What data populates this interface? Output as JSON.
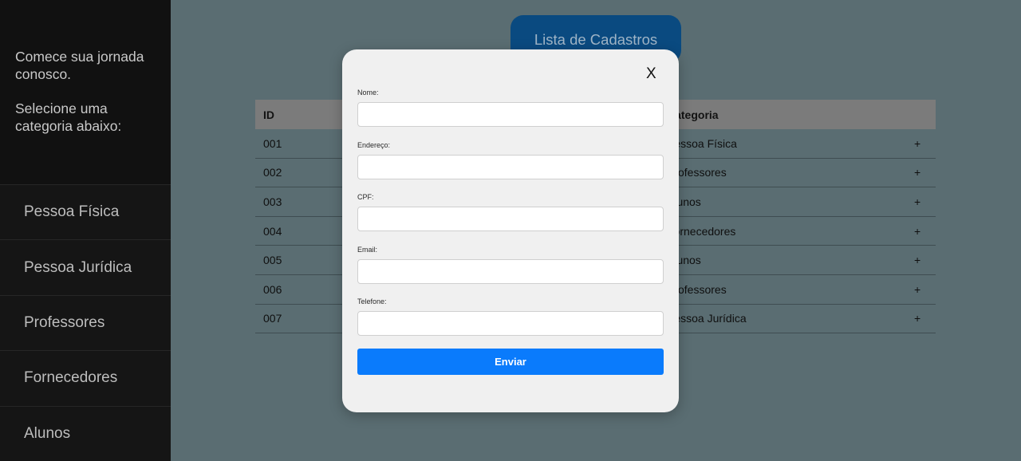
{
  "sidebar": {
    "intro_line1": "Comece sua jornada conosco.",
    "intro_line2": "Selecione uma categoria abaixo:",
    "items": [
      {
        "label": "Pessoa Física"
      },
      {
        "label": "Pessoa Jurídica"
      },
      {
        "label": "Professores"
      },
      {
        "label": "Fornecedores"
      },
      {
        "label": "Alunos"
      }
    ]
  },
  "header": {
    "button_label": "Lista de Cadastros"
  },
  "table": {
    "columns": [
      "ID",
      "Categoria"
    ],
    "rows": [
      {
        "id": "001",
        "category": "Pessoa Física",
        "action": "+"
      },
      {
        "id": "002",
        "category": "Professores",
        "action": "+"
      },
      {
        "id": "003",
        "category": "Alunos",
        "action": "+"
      },
      {
        "id": "004",
        "category": "Fornecedores",
        "action": "+"
      },
      {
        "id": "005",
        "category": "Alunos",
        "action": "+"
      },
      {
        "id": "006",
        "category": "Professores",
        "action": "+"
      },
      {
        "id": "007",
        "category": "Pessoa Jurídica",
        "action": "+"
      }
    ]
  },
  "modal": {
    "close_label": "X",
    "fields": [
      {
        "label": "Nome:",
        "value": ""
      },
      {
        "label": "Endereço:",
        "value": ""
      },
      {
        "label": "CPF:",
        "value": ""
      },
      {
        "label": "Email:",
        "value": ""
      },
      {
        "label": "Telefone:",
        "value": ""
      }
    ],
    "submit_label": "Enviar"
  },
  "colors": {
    "page_background": "#5a6d72",
    "sidebar_background": "#111111",
    "header_button": "#0a4a80",
    "submit_button": "#0a7bfc",
    "modal_background": "#f0f0f0"
  }
}
